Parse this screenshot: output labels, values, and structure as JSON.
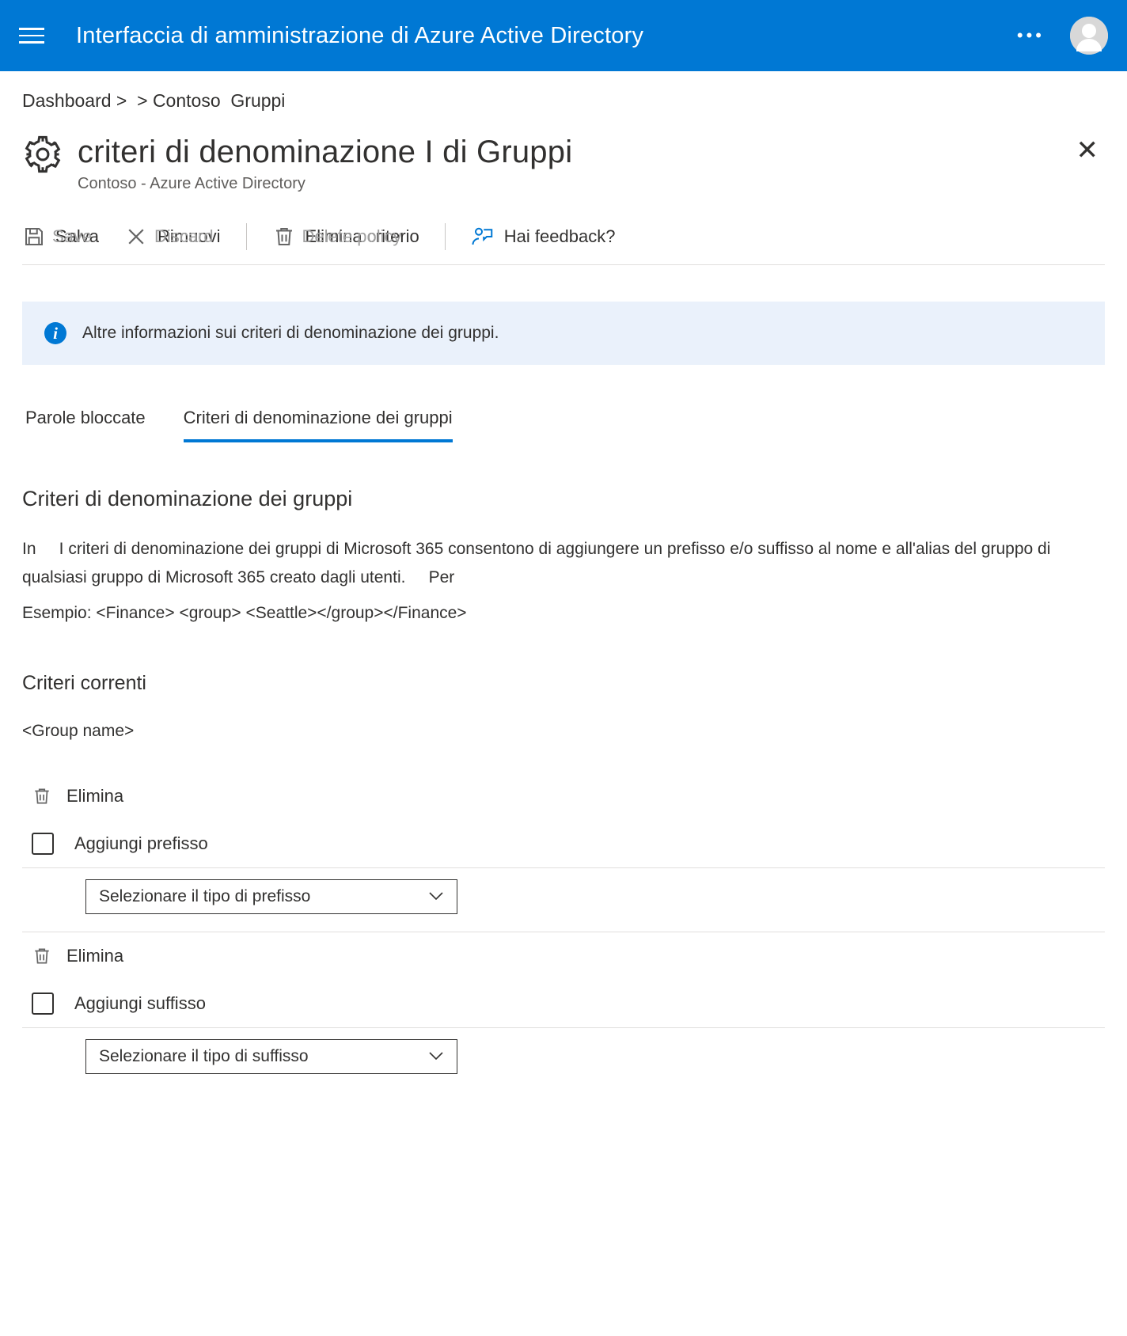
{
  "topbar": {
    "title": "Interfaccia di amministrazione di Azure Active Directory"
  },
  "breadcrumb": "Dashboard >  > Contoso  Gruppi",
  "page": {
    "title": "criteri di denominazione I di Gruppi",
    "subtitle": "Contoso - Azure Active Directory"
  },
  "toolbar": {
    "save": "Salva",
    "save_ghost": "Save",
    "discard": "Rimuovi",
    "discard_ghost": "Discard",
    "delete_policy": "Elimina criterio",
    "delete_policy_ghost": "Delete policy",
    "feedback": "Hai feedback?"
  },
  "info_banner": "Altre informazioni sui criteri di denominazione dei gruppi.",
  "tabs": {
    "blocked_words": "Parole bloccate",
    "group_naming": "Criteri di denominazione dei gruppi"
  },
  "section": {
    "heading": "Criteri di denominazione dei gruppi",
    "description": "In     I criteri di denominazione dei gruppi di Microsoft 365 consentono di aggiungere un prefisso e/o suffisso al nome e all'alias del gruppo di qualsiasi gruppo di Microsoft 365 creato dagli utenti.     Per",
    "example": "Esempio: <Finance> <group> <Seattle></group></Finance>"
  },
  "current_policy": {
    "heading": "Criteri correnti",
    "preview": "<Group name>",
    "rows": [
      {
        "delete_label": "Elimina",
        "add_label": "Aggiungi prefisso",
        "select_placeholder": "Selezionare il tipo di prefisso"
      },
      {
        "delete_label": "Elimina",
        "add_label": "Aggiungi suffisso",
        "select_placeholder": "Selezionare il tipo di suffisso"
      }
    ]
  }
}
